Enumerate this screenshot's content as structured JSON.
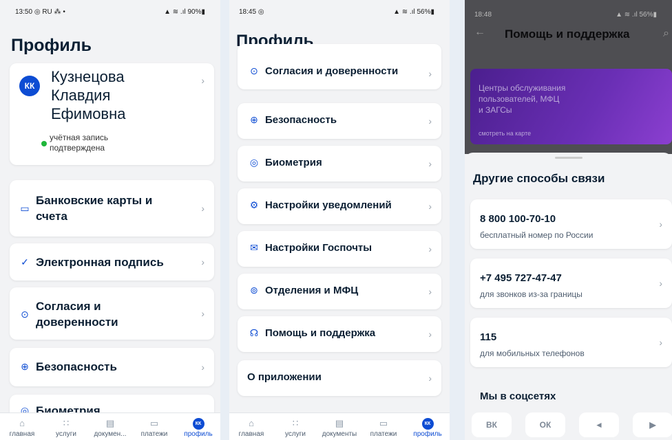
{
  "p1": {
    "time": "13:50",
    "status_left_icons": "◎ RU ⁂ •",
    "status_right": "▲ ≋ .ıl 90%▮",
    "title": "Профиль",
    "user": {
      "initials": "КК",
      "name_line1": "Кузнецова",
      "name_line2": "Клавдия",
      "name_line3": "Ефимовна",
      "verified_line1": "учётная запись",
      "verified_line2": "подтверждена"
    },
    "items": [
      {
        "icon": "▭",
        "label1": "Банковские карты и",
        "label2": "счета"
      },
      {
        "icon": "✓",
        "label1": "Электронная подпись"
      },
      {
        "icon": "⊙",
        "label1": "Согласия и",
        "label2": "доверенности"
      },
      {
        "icon": "⊕",
        "label1": "Безопасность"
      },
      {
        "icon": "◎",
        "label1": "Биометрия"
      }
    ]
  },
  "p2": {
    "time": "18:45",
    "status_left_icons": "◎",
    "status_right": "▲ ≋ .ıl 56%▮",
    "title": "Профиль",
    "items": [
      {
        "icon": "⊙",
        "label": "Согласия и доверенности"
      },
      {
        "icon": "⊕",
        "label": "Безопасность"
      },
      {
        "icon": "◎",
        "label": "Биометрия"
      },
      {
        "icon": "⚙",
        "label": "Настройки уведомлений"
      },
      {
        "icon": "✉",
        "label": "Настройки Госпочты"
      },
      {
        "icon": "⊚",
        "label": "Отделения и МФЦ"
      },
      {
        "icon": "☊",
        "label": "Помощь и поддержка"
      },
      {
        "icon": "",
        "label": "О приложении"
      }
    ]
  },
  "p3": {
    "time": "18:48",
    "status_right": "▲ ≋ .ıl 56%▮",
    "title": "Помощь и поддержка",
    "banner_l1": "Центры обслуживания",
    "banner_l2": "пользователей, МФЦ",
    "banner_l3": "и ЗАГСы",
    "banner_link": "смотреть на карте",
    "section": "Другие способы связи",
    "phones": [
      {
        "number": "8 800 100-70-10",
        "desc": "бесплатный номер по России"
      },
      {
        "number": "+7 495 727-47-47",
        "desc": "для звонков из-за границы"
      },
      {
        "number": "115",
        "desc": "для мобильных телефонов"
      }
    ],
    "social_title": "Мы в соцсетях",
    "social": [
      {
        "icon": "ВК"
      },
      {
        "icon": "ОК"
      },
      {
        "icon": "◄"
      },
      {
        "icon": "▶"
      }
    ]
  },
  "tabs1": [
    "главная",
    "услуги",
    "докумен...",
    "платежи",
    "профиль"
  ],
  "tabs2": [
    "главная",
    "услуги",
    "документы",
    "платежи",
    "профиль"
  ],
  "tab_icons": [
    "⌂",
    "∷",
    "▤",
    "▭",
    "КК"
  ]
}
